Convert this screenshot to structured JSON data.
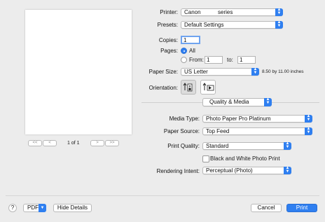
{
  "preview": {
    "page_counter": "1 of 1",
    "first_label": "<<",
    "prev_label": "<",
    "next_label": ">",
    "last_label": ">>"
  },
  "printer": {
    "label": "Printer:",
    "value": "Canon           series"
  },
  "presets": {
    "label": "Presets:",
    "value": "Default Settings"
  },
  "copies": {
    "label": "Copies:",
    "value": "1"
  },
  "pages": {
    "label": "Pages:",
    "all_label": "All",
    "from_label": "From:",
    "from_value": "1",
    "to_label": "to:",
    "to_value": "1",
    "selected": "all"
  },
  "paper_size": {
    "label": "Paper Size:",
    "value": "US Letter",
    "dimensions": "8.50 by 11.00 inches"
  },
  "orientation": {
    "label": "Orientation:",
    "selected": "portrait"
  },
  "section": {
    "value": "Quality & Media"
  },
  "media_type": {
    "label": "Media Type:",
    "value": "Photo Paper Pro Platinum"
  },
  "paper_source": {
    "label": "Paper Source:",
    "value": "Top Feed"
  },
  "print_quality": {
    "label": "Print Quality:",
    "value": "Standard"
  },
  "bw_photo": {
    "label": "Black and White Photo Print",
    "checked": false
  },
  "rendering_intent": {
    "label": "Rendering Intent:",
    "value": "Perceptual (Photo)"
  },
  "footer": {
    "help_label": "?",
    "pdf_label": "PDF",
    "hide_details_label": "Hide Details",
    "cancel_label": "Cancel",
    "print_label": "Print"
  },
  "colors": {
    "accent": "#2f7ff0",
    "background": "#ececec"
  }
}
